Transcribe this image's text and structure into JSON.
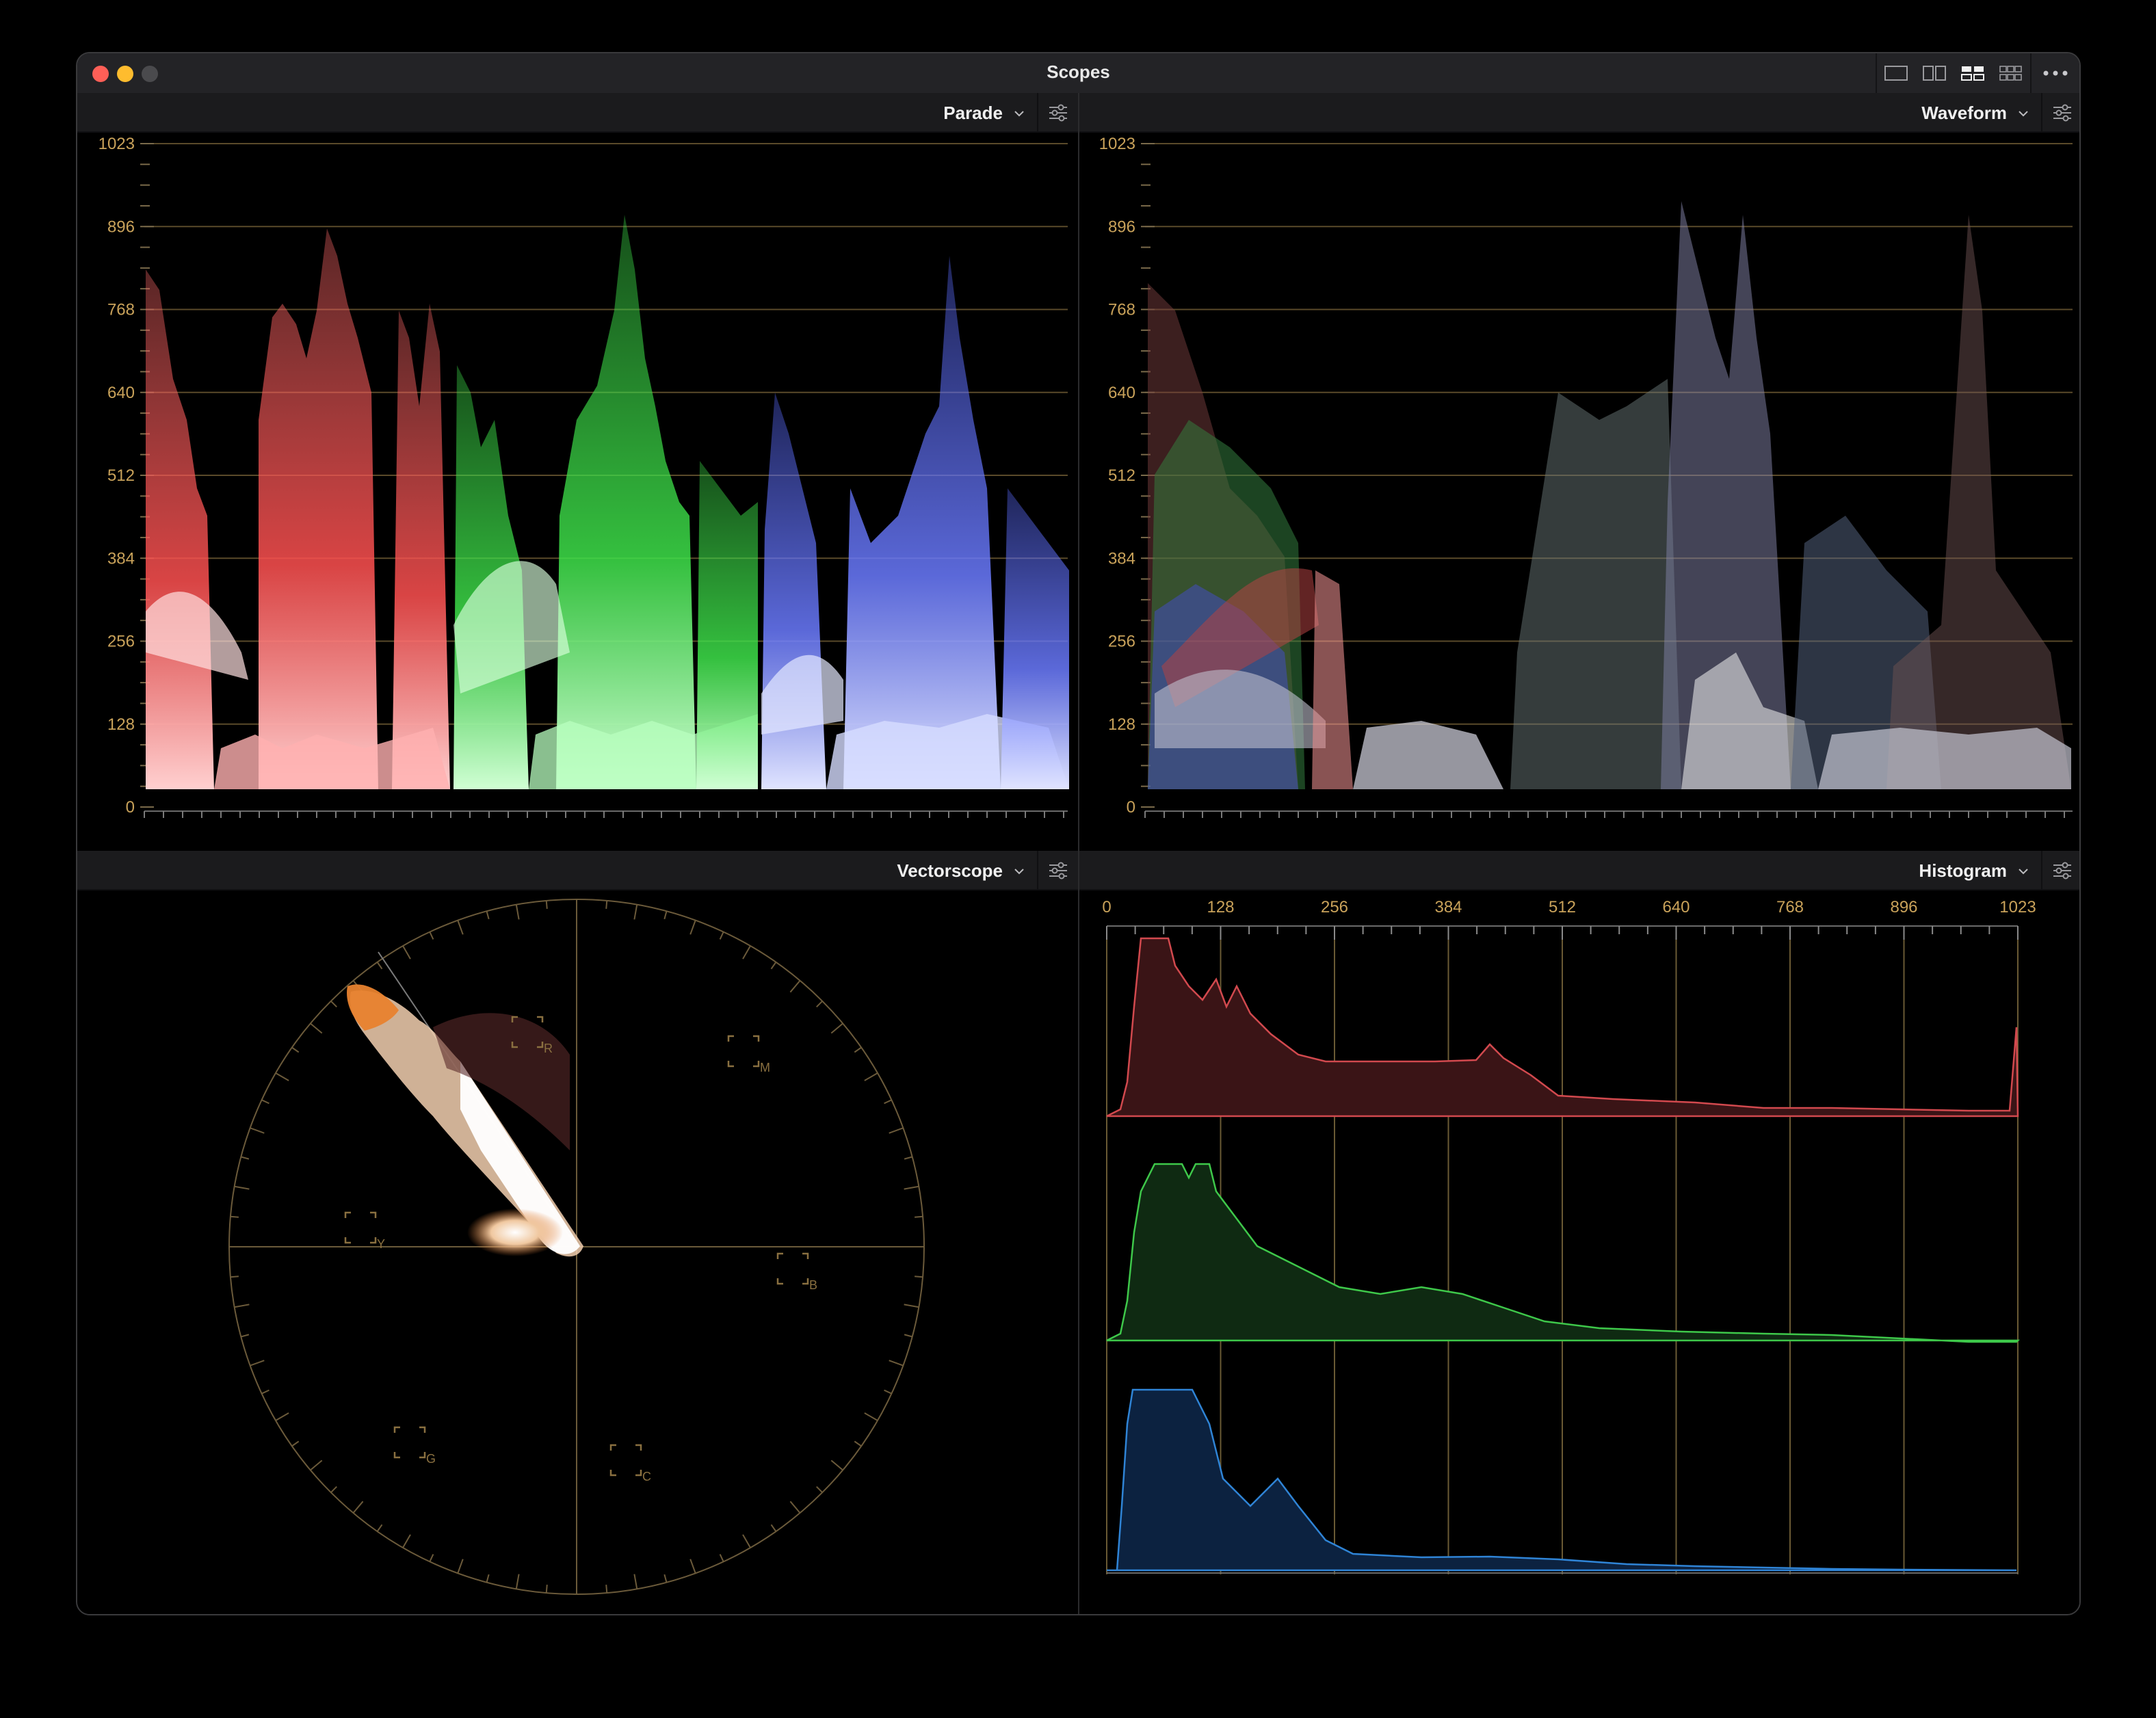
{
  "window": {
    "title": "Scopes"
  },
  "toolbar": {
    "layout_icons": [
      "single-layout-icon",
      "dual-layout-icon",
      "quad-layout-icon",
      "grid-layout-icon"
    ],
    "more_icon": "ellipsis-icon"
  },
  "colors": {
    "accent_gold": "#c9a25a",
    "red": "#ff5a5a",
    "green": "#3ee24a",
    "blue": "#5a6bff"
  },
  "panels": {
    "parade": {
      "title": "Parade"
    },
    "waveform": {
      "title": "Waveform"
    },
    "vectorscope": {
      "title": "Vectorscope",
      "targets": [
        "R",
        "M",
        "Y",
        "B",
        "G",
        "C"
      ]
    },
    "histogram": {
      "title": "Histogram"
    }
  },
  "scale": {
    "ticks": [
      "0",
      "128",
      "256",
      "384",
      "512",
      "640",
      "768",
      "896",
      "1023"
    ]
  }
}
